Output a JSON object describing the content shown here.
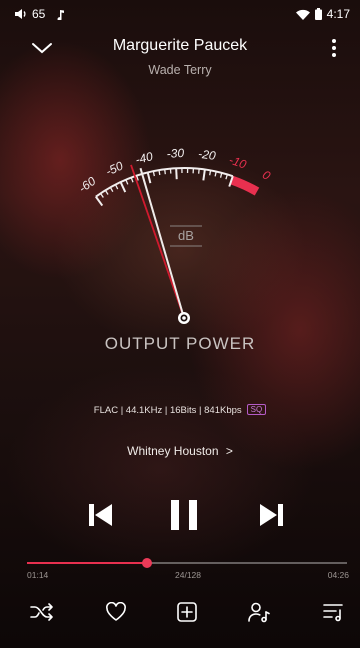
{
  "status_bar": {
    "volume": "65",
    "time": "4:17",
    "icons": [
      "volume-icon",
      "music-note-icon",
      "wifi-icon",
      "battery-icon"
    ]
  },
  "header": {
    "title": "Marguerite Paucek",
    "artist": "Wade Terry",
    "collapse_icon": "chevron-down-icon",
    "menu_icon": "more-vertical-icon"
  },
  "meter": {
    "scale_labels": [
      "-60",
      "-50",
      "-40",
      "-30",
      "-20",
      "-10",
      "0"
    ],
    "unit": "dB",
    "label": "OUTPUT POWER",
    "needle_value_db": -42,
    "peak_value_db": -41,
    "colors": {
      "scale": "#f2eeee",
      "hot_zone": "#e8304f",
      "needle": "#f0ecea",
      "peak": "#d01a2e"
    }
  },
  "track_info": {
    "format": "FLAC | 44.1KHz | 16Bits | 841Kbps",
    "quality_badge": "SQ"
  },
  "related": {
    "label": "Whitney Houston",
    "chevron": ">"
  },
  "playback": {
    "state": "playing",
    "current_time": "01:14",
    "duration": "04:26",
    "queue_position": "24/128",
    "progress_fraction": 0.375
  },
  "toolbar": {
    "items": [
      "shuffle-icon",
      "favorite-icon",
      "add-to-playlist-icon",
      "artist-icon",
      "queue-icon"
    ]
  },
  "colors": {
    "accent": "#e8304f",
    "badge": "#b45bc7"
  }
}
